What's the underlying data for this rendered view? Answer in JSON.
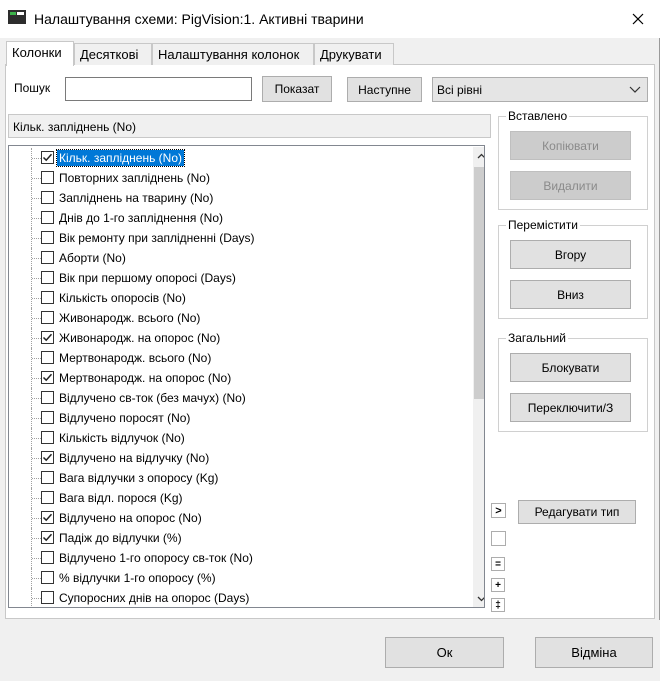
{
  "window": {
    "title": "Налаштування схеми: PigVision:1. Активні тварини"
  },
  "tabs": [
    {
      "label": "Колонки",
      "active": true
    },
    {
      "label": "Десяткові",
      "active": false
    },
    {
      "label": "Налаштування колонок",
      "active": false
    },
    {
      "label": "Друкувати",
      "active": false
    }
  ],
  "search": {
    "label": "Пошук",
    "value": "",
    "show_button": "Показат",
    "next_button": "Наступне"
  },
  "level_combo": {
    "value": "Всі рівні"
  },
  "selected_field": "Кільк. запліднень (No)",
  "columns": [
    {
      "label": "Кільк. запліднень (No)",
      "checked": true,
      "selected": true
    },
    {
      "label": "Повторних запліднень (No)",
      "checked": false
    },
    {
      "label": "Запліднень на тварину (No)",
      "checked": false
    },
    {
      "label": "Днів до 1-го запліднення (No)",
      "checked": false
    },
    {
      "label": "Вік ремонту при заплідненні (Days)",
      "checked": false
    },
    {
      "label": "Аборти (No)",
      "checked": false
    },
    {
      "label": "Вік при першому опоросі (Days)",
      "checked": false
    },
    {
      "label": "Кількість опоросів (No)",
      "checked": false
    },
    {
      "label": "Живонародж. всього (No)",
      "checked": false
    },
    {
      "label": "Живонародж. на опорос (No)",
      "checked": true
    },
    {
      "label": "Мертвонародж. всього (No)",
      "checked": false
    },
    {
      "label": "Мертвонародж. на опорос (No)",
      "checked": true
    },
    {
      "label": "Відлучено св-ток (без мачух) (No)",
      "checked": false
    },
    {
      "label": "Відлучено поросят (No)",
      "checked": false
    },
    {
      "label": "Кількість відлучок (No)",
      "checked": false
    },
    {
      "label": "Відлучено на відлучку (No)",
      "checked": true
    },
    {
      "label": "Вага відлучки з опоросу (Kg)",
      "checked": false
    },
    {
      "label": "Вага відл. порося (Kg)",
      "checked": false
    },
    {
      "label": "Відлучено на опорос (No)",
      "checked": true
    },
    {
      "label": "Падіж до відлучки (%)",
      "checked": true
    },
    {
      "label": "Відлучено 1-го опоросу св-ток (No)",
      "checked": false
    },
    {
      "label": "% відлучки 1-го опоросу (%)",
      "checked": false
    },
    {
      "label": "Супоросних днів на опорос (Days)",
      "checked": false
    }
  ],
  "inserted_group": {
    "title": "Вставлено",
    "copy": "Копіювати",
    "delete": "Видалити"
  },
  "move_group": {
    "title": "Перемістити",
    "up": "Вгору",
    "down": "Вниз"
  },
  "general_group": {
    "title": "Загальний",
    "lock": "Блокувати",
    "switch": "Переключити/З"
  },
  "side_controls": {
    "expand": ">",
    "collapse": "=",
    "plus": "+",
    "both": "‡"
  },
  "edit_type_button": "Редагувати тип",
  "footer": {
    "ok": "Ок",
    "cancel": "Відміна"
  },
  "colors": {
    "selection": "#0078d7",
    "face": "#f0f0f0",
    "button": "#e1e1e1"
  }
}
